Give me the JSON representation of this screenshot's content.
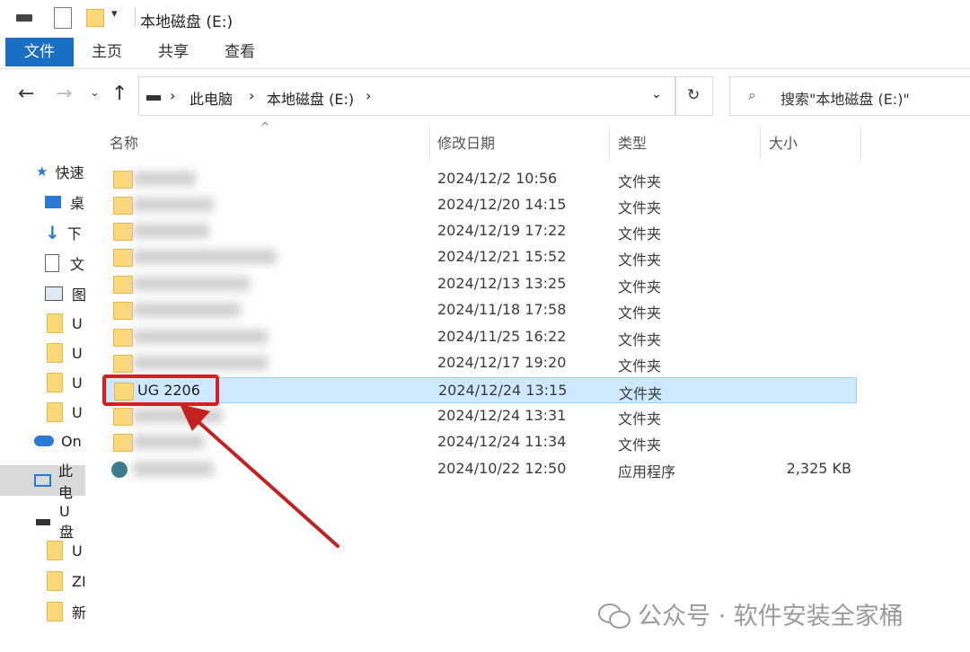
{
  "window": {
    "title": "本地磁盘 (E:)"
  },
  "ribbon": {
    "tabs": [
      "文件",
      "主页",
      "共享",
      "查看"
    ]
  },
  "address": {
    "crumbs": [
      "此电脑",
      "本地磁盘 (E:)"
    ]
  },
  "search": {
    "placeholder": "搜索\"本地磁盘 (E:)\""
  },
  "columns": {
    "name": "名称",
    "date": "修改日期",
    "type": "类型",
    "size": "大小"
  },
  "sidebar": {
    "items": [
      {
        "icon": "star-icon",
        "label": "快速"
      },
      {
        "icon": "desktop-icon",
        "label": "桌"
      },
      {
        "icon": "download-icon",
        "label": "下"
      },
      {
        "icon": "document-icon",
        "label": "文"
      },
      {
        "icon": "picture-icon",
        "label": "图"
      },
      {
        "icon": "folder-icon",
        "label": "U"
      },
      {
        "icon": "folder-icon",
        "label": "U"
      },
      {
        "icon": "folder-icon",
        "label": "U"
      },
      {
        "icon": "folder-icon",
        "label": "U"
      },
      {
        "icon": "onedrive-icon",
        "label": "On"
      },
      {
        "icon": "computer-icon",
        "label": "此电"
      },
      {
        "icon": "drive-icon",
        "label": "U 盘"
      },
      {
        "icon": "folder-icon",
        "label": "U"
      },
      {
        "icon": "folder-icon",
        "label": "ZI"
      },
      {
        "icon": "folder-icon",
        "label": "新"
      }
    ]
  },
  "files": [
    {
      "name": "",
      "date": "2024/12/2 10:56",
      "type": "文件夹",
      "size": ""
    },
    {
      "name": "",
      "date": "2024/12/20 14:15",
      "type": "文件夹",
      "size": ""
    },
    {
      "name": "",
      "date": "2024/12/19 17:22",
      "type": "文件夹",
      "size": ""
    },
    {
      "name": "",
      "date": "2024/12/21 15:52",
      "type": "文件夹",
      "size": ""
    },
    {
      "name": "",
      "date": "2024/12/13 13:25",
      "type": "文件夹",
      "size": ""
    },
    {
      "name": "",
      "date": "2024/11/18 17:58",
      "type": "文件夹",
      "size": ""
    },
    {
      "name": "",
      "date": "2024/11/25 16:22",
      "type": "文件夹",
      "size": ""
    },
    {
      "name": "",
      "date": "2024/12/17 19:20",
      "type": "文件夹",
      "size": ""
    },
    {
      "name": "UG 2206",
      "date": "2024/12/24 13:15",
      "type": "文件夹",
      "size": ""
    },
    {
      "name": "",
      "date": "2024/12/24 13:31",
      "type": "文件夹",
      "size": ""
    },
    {
      "name": "",
      "date": "2024/12/24 11:34",
      "type": "文件夹",
      "size": ""
    },
    {
      "name": "",
      "date": "2024/10/22 12:50",
      "type": "应用程序",
      "size": "2,325 KB"
    }
  ],
  "watermark": {
    "text": "公众号 · 软件安装全家桶"
  },
  "colors": {
    "accent": "#1a6ec4",
    "selection": "#cde8ff",
    "highlight": "#d42020",
    "folder": "#fbd87a"
  }
}
